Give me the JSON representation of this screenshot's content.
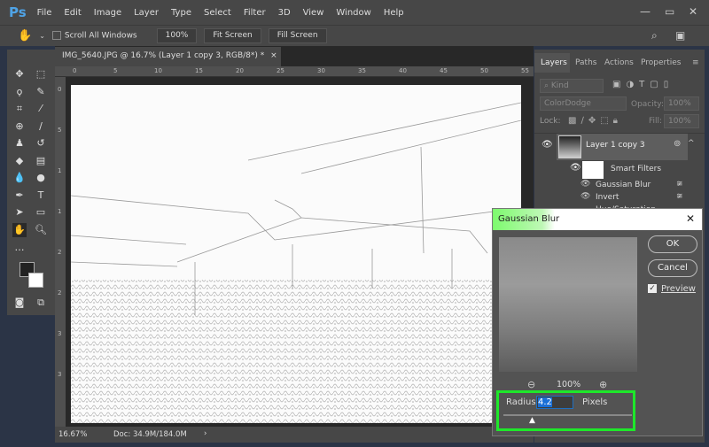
{
  "app": {
    "logo": "Ps",
    "menu": [
      "File",
      "Edit",
      "Image",
      "Layer",
      "Type",
      "Select",
      "Filter",
      "3D",
      "View",
      "Window",
      "Help"
    ]
  },
  "options": {
    "scroll_all": "Scroll All Windows",
    "zoom100": "100%",
    "fit": "Fit Screen",
    "fill": "Fill Screen"
  },
  "document": {
    "tab_title": "IMG_5640.JPG @ 16.7% (Layer 1 copy 3, RGB/8*) *",
    "hruler": [
      "0",
      "5",
      "10",
      "15",
      "20",
      "25",
      "30",
      "35",
      "40",
      "45",
      "50",
      "55"
    ],
    "vruler": [
      "0",
      "5",
      "1",
      "1",
      "2",
      "2",
      "3",
      "3"
    ],
    "zoom": "16.67%",
    "doc_size": "Doc: 34.9M/184.0M"
  },
  "layers": {
    "tabs": [
      "Layers",
      "Paths",
      "Actions",
      "Properties"
    ],
    "kind": "Kind",
    "blend": "ColorDodge",
    "opacity_label": "Opacity:",
    "opacity": "100%",
    "lock_label": "Lock:",
    "fill_label": "Fill:",
    "fill": "100%",
    "layer_name": "Layer 1 copy 3",
    "smart_filters": "Smart Filters",
    "filters": [
      "Gaussian Blur",
      "Invert",
      "Hue/Saturation"
    ]
  },
  "dialog": {
    "title": "Gaussian Blur",
    "ok": "OK",
    "cancel": "Cancel",
    "preview": "Preview",
    "preview_checked": true,
    "zoom": "100%",
    "radius_label": "Radius:",
    "radius": "4.2",
    "unit": "Pixels",
    "highlight_color": "#1ee82a"
  }
}
